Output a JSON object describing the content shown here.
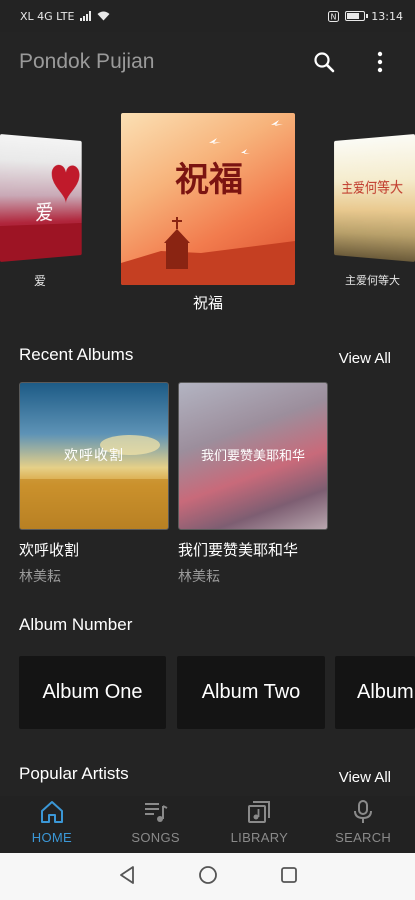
{
  "status_bar": {
    "carrier": "XL 4G LTE",
    "time": "13:14",
    "battery_level": 0.75
  },
  "app_bar": {
    "title": "Pondok Pujian"
  },
  "carousel": {
    "items": [
      {
        "label": "爱",
        "cover_text": "爱"
      },
      {
        "label": "祝福",
        "cover_text": "祝福"
      },
      {
        "label": "主爱何等大",
        "cover_text": "主爱何等大"
      }
    ]
  },
  "recent_albums": {
    "title": "Recent Albums",
    "view_all": "View All",
    "items": [
      {
        "name": "欢呼收割",
        "artist": "林美耘",
        "cover_text": "欢呼收割"
      },
      {
        "name": "我们要赞美耶和华",
        "artist": "林美耘",
        "cover_text": "我们要赞美耶和华"
      }
    ]
  },
  "album_number": {
    "title": "Album Number",
    "items": [
      "Album One",
      "Album Two",
      "Album"
    ]
  },
  "popular_artists": {
    "title": "Popular Artists",
    "view_all": "View All"
  },
  "bottom_nav": {
    "active": "home",
    "items": [
      {
        "id": "home",
        "label": "HOME",
        "icon": "home-icon"
      },
      {
        "id": "songs",
        "label": "SONGS",
        "icon": "music-list-icon"
      },
      {
        "id": "library",
        "label": "LIBRARY",
        "icon": "library-icon"
      },
      {
        "id": "search",
        "label": "SEARCH",
        "icon": "microphone-icon"
      }
    ]
  },
  "colors": {
    "accent": "#3b97d6",
    "background": "#242424",
    "card": "#141414"
  }
}
